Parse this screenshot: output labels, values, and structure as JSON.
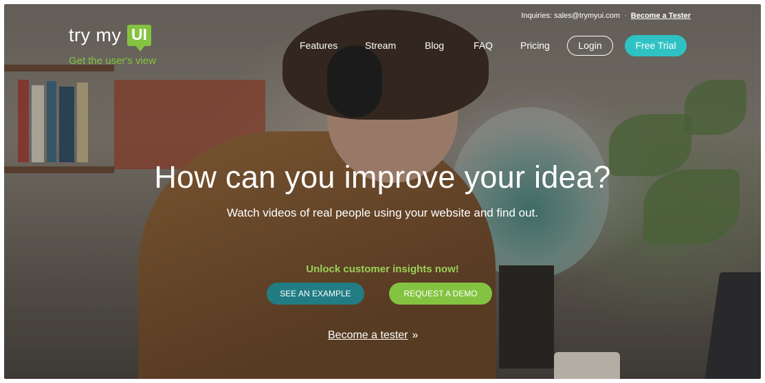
{
  "header": {
    "logo_word": "try my",
    "logo_box": "UI",
    "tagline": "Get the user's view",
    "inquiries": "Inquiries: sales@trymyui.com",
    "separator": "·",
    "become_tester_top": "Become a Tester"
  },
  "nav": {
    "items": [
      "Features",
      "Stream",
      "Blog",
      "FAQ",
      "Pricing"
    ],
    "login": "Login",
    "free_trial": "Free Trial"
  },
  "hero": {
    "headline": "How can you improve your idea?",
    "subhead": "Watch videos of real people using your website and find out.",
    "unlock": "Unlock customer insights now!",
    "see_example": "SEE AN EXAMPLE",
    "request_demo": "REQUEST A DEMO",
    "become_tester": "Become a tester",
    "become_arrow": "»"
  },
  "colors": {
    "brand_green": "#84c341",
    "trial_teal": "#2fc2c4",
    "example_teal": "#217d83"
  }
}
